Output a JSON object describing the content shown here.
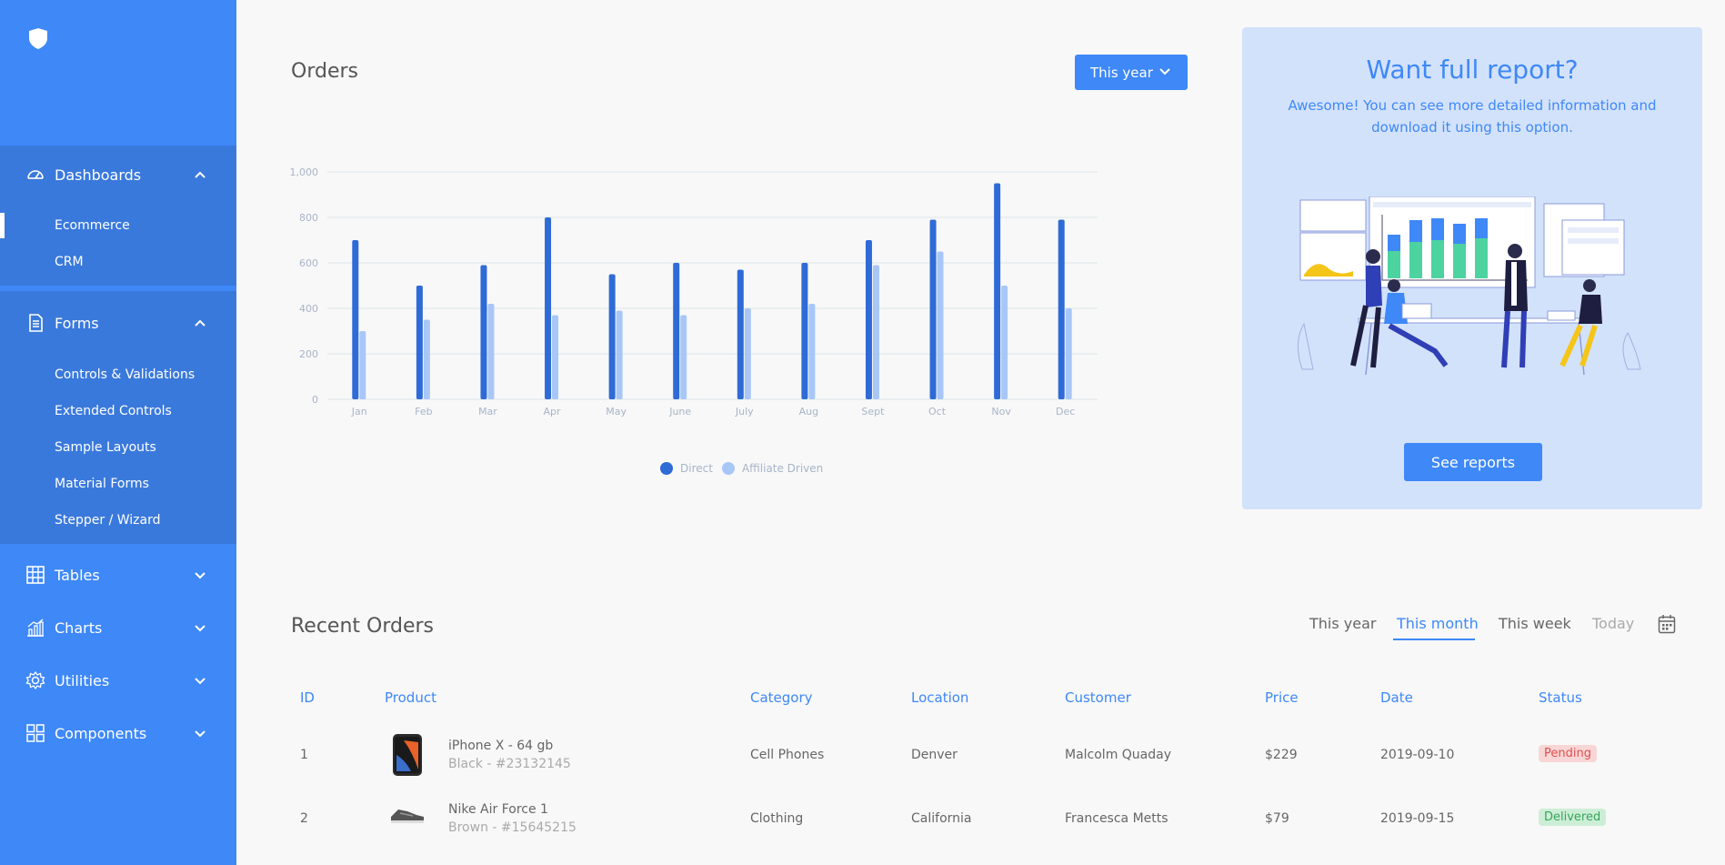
{
  "sidebar": {
    "groups": [
      {
        "label": "Dashboards",
        "items": [
          "Ecommerce",
          "CRM"
        ]
      },
      {
        "label": "Forms",
        "items": [
          "Controls & Validations",
          "Extended Controls",
          "Sample Layouts",
          "Material Forms",
          "Stepper / Wizard"
        ]
      }
    ],
    "plain": [
      "Tables",
      "Charts",
      "Utilities",
      "Components"
    ]
  },
  "orders": {
    "title": "Orders",
    "range_button": "This year"
  },
  "chart_data": {
    "type": "bar",
    "categories": [
      "Jan",
      "Feb",
      "Mar",
      "Apr",
      "May",
      "June",
      "July",
      "Aug",
      "Sept",
      "Oct",
      "Nov",
      "Dec"
    ],
    "series": [
      {
        "name": "Direct",
        "values": [
          700,
          500,
          590,
          800,
          550,
          600,
          570,
          600,
          700,
          790,
          950,
          790
        ]
      },
      {
        "name": "Affiliate Driven",
        "values": [
          300,
          350,
          420,
          370,
          390,
          370,
          400,
          420,
          590,
          650,
          500,
          400
        ]
      }
    ],
    "yticks": [
      "0",
      "200",
      "400",
      "600",
      "800",
      "1,000"
    ],
    "ylim": [
      0,
      1000
    ],
    "colors": [
      "#2f6bd6",
      "#a8c7f7"
    ],
    "grid": true,
    "legend": "bottom"
  },
  "report": {
    "title": "Want full report?",
    "text": "Awesome! You can see more detailed information and download it using this option.",
    "button": "See reports"
  },
  "recent": {
    "title": "Recent Orders",
    "filters": [
      "This year",
      "This month",
      "This week",
      "Today"
    ],
    "active_filter": "This month",
    "columns": [
      "ID",
      "Product",
      "Category",
      "Location",
      "Customer",
      "Price",
      "Date",
      "Status"
    ],
    "rows": [
      {
        "id": "1",
        "product": "iPhone X - 64 gb",
        "variant": "Black - #23132145",
        "category": "Cell Phones",
        "location": "Denver",
        "customer": "Malcolm Quaday",
        "price": "$229",
        "date": "2019-09-10",
        "status": "Pending"
      },
      {
        "id": "2",
        "product": "Nike Air Force 1",
        "variant": "Brown - #15645215",
        "category": "Clothing",
        "location": "California",
        "customer": "Francesca Metts",
        "price": "$79",
        "date": "2019-09-15",
        "status": "Delivered"
      }
    ]
  },
  "icons": {
    "logo": "shield-logo-icon",
    "dashboards": "gauge-icon",
    "forms": "document-icon",
    "tables": "table-grid-icon",
    "charts": "bar-chart-icon",
    "utilities": "gear-icon",
    "components": "grid-icon",
    "calendar": "calendar-icon"
  }
}
